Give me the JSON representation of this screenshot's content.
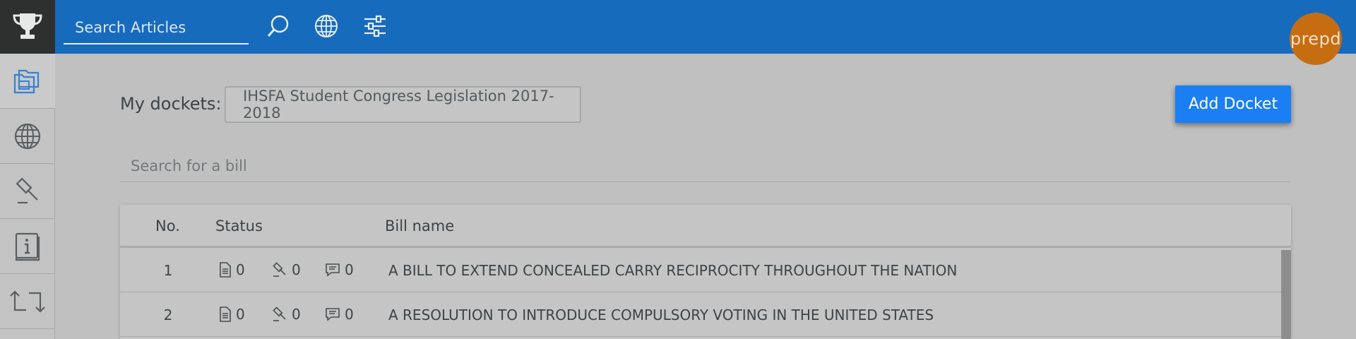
{
  "topbar": {
    "search_placeholder": "Search Articles",
    "avatar_text": "prepd",
    "brand_color": "#176bbd",
    "avatar_color": "#c66d12",
    "icons": [
      "search-icon",
      "globe-icon",
      "filter-sliders-icon"
    ]
  },
  "sidebar": {
    "logo_icon": "trophy-icon",
    "items": [
      {
        "icon": "folders-icon",
        "active": true
      },
      {
        "icon": "globe-icon",
        "active": false
      },
      {
        "icon": "gavel-icon",
        "active": false
      },
      {
        "icon": "info-book-icon",
        "active": false
      },
      {
        "icon": "switch-arrows-icon",
        "active": false
      }
    ]
  },
  "dockets": {
    "label": "My dockets:",
    "selected": "IHSFA Student Congress Legislation 2017-2018",
    "add_button": "Add Docket",
    "add_button_color": "#1a7ff2"
  },
  "bill_search": {
    "placeholder": "Search for a bill"
  },
  "table": {
    "headers": {
      "no": "No.",
      "status": "Status",
      "bill_name": "Bill name"
    },
    "rows": [
      {
        "no": "1",
        "docs": "0",
        "gavels": "0",
        "comments": "0",
        "name": "A BILL TO EXTEND CONCEALED CARRY RECIPROCITY THROUGHOUT THE NATION"
      },
      {
        "no": "2",
        "docs": "0",
        "gavels": "0",
        "comments": "0",
        "name": "A RESOLUTION TO INTRODUCE COMPULSORY VOTING IN THE UNITED STATES"
      }
    ]
  }
}
